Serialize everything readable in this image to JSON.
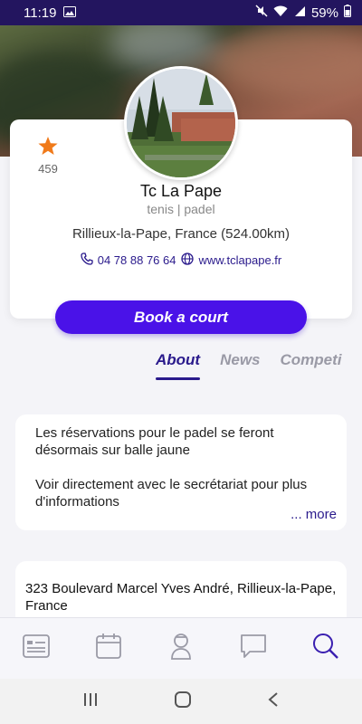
{
  "status_bar": {
    "time": "11:19",
    "battery": "59%"
  },
  "club": {
    "rating_count": "459",
    "name": "Tc La Pape",
    "sports": "tenis | padel",
    "location": "Rillieux-la-Pape, France (524.00km)",
    "phone": "04 78 88 76 64",
    "website": "www.tclapape.fr"
  },
  "actions": {
    "book_label": "Book a court"
  },
  "tabs": [
    {
      "label": "About",
      "active": true
    },
    {
      "label": "News",
      "active": false
    },
    {
      "label": "Competi",
      "active": false
    }
  ],
  "about": {
    "line1": "Les réservations pour le padel se feront désormais sur balle jaune",
    "line2": "Voir directement avec le secrétariat pour plus d'informations",
    "more_label": "... more"
  },
  "address": {
    "text": "323 Boulevard Marcel Yves André, Rillieux-la-Pape, France"
  },
  "bottom_nav": [
    {
      "icon": "card-icon"
    },
    {
      "icon": "calendar-icon"
    },
    {
      "icon": "coach-icon"
    },
    {
      "icon": "chat-icon"
    },
    {
      "icon": "search-icon",
      "active": true
    }
  ],
  "colors": {
    "accent": "#4a12e8",
    "dark_accent": "#2a1a8c",
    "star": "#f07a1a"
  }
}
